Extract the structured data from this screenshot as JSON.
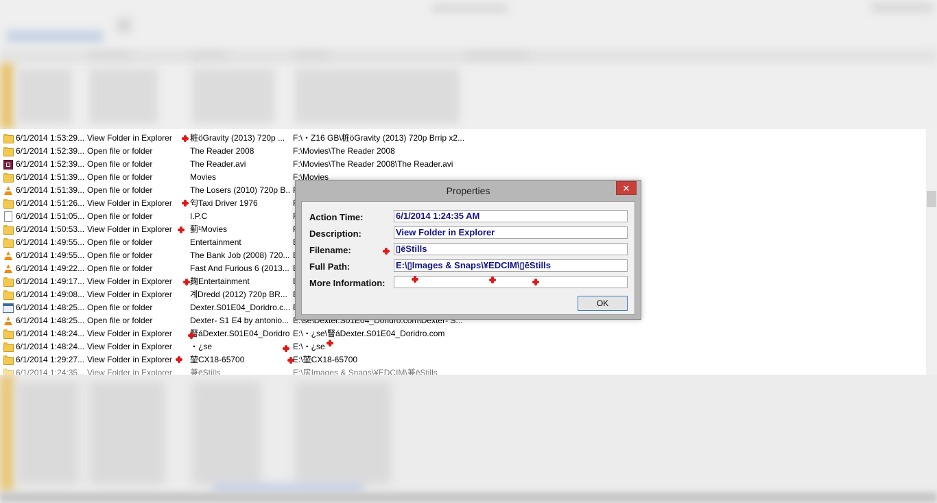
{
  "dialog": {
    "title": "Properties",
    "close_glyph": "✕",
    "ok_label": "OK",
    "fields": [
      {
        "label": "Action Time:",
        "value": "6/1/2014 1:24:35 AM"
      },
      {
        "label": "Description:",
        "value": "View Folder in Explorer"
      },
      {
        "label": "Filename:",
        "value": "▯ēStills"
      },
      {
        "label": "Full Path:",
        "value": "E:\\▯Images & Snaps\\¥EDCIM\\▯ēStills"
      },
      {
        "label": "More Information:",
        "value": ""
      }
    ]
  },
  "list": {
    "rows": [
      {
        "icon": "folder-icon",
        "time": "6/1/2014 1:53:29...",
        "desc": "View Folder in Explorer",
        "file": "粧ӧGravity (2013) 720p ...",
        "path": "F:\\・Z16 GB\\粧ӧGravity (2013) 720p Brrip x2..."
      },
      {
        "icon": "folder-icon",
        "time": "6/1/2014 1:52:39...",
        "desc": "Open file or folder",
        "file": "The Reader 2008",
        "path": "F:\\Movies\\The Reader 2008"
      },
      {
        "icon": "video-file-icon",
        "time": "6/1/2014 1:52:39...",
        "desc": "Open file or folder",
        "file": "The Reader.avi",
        "path": "F:\\Movies\\The Reader 2008\\The Reader.avi"
      },
      {
        "icon": "folder-icon",
        "time": "6/1/2014 1:51:39...",
        "desc": "Open file or folder",
        "file": "Movies",
        "path": "F:\\Movies"
      },
      {
        "icon": "vlc-icon",
        "time": "6/1/2014 1:51:39...",
        "desc": "Open file or folder",
        "file": "The Losers (2010) 720p B...",
        "path": "F"
      },
      {
        "icon": "folder-icon",
        "time": "6/1/2014 1:51:26...",
        "desc": "View Folder in Explorer",
        "file": "匄Taxi Driver 1976",
        "path": "F"
      },
      {
        "icon": "file-icon",
        "time": "6/1/2014 1:51:05...",
        "desc": "Open file or folder",
        "file": "I.P.C",
        "path": "F"
      },
      {
        "icon": "folder-icon",
        "time": "6/1/2014 1:50:53...",
        "desc": "View Folder in Explorer",
        "file": "蓟¹Movies",
        "path": "F"
      },
      {
        "icon": "folder-icon",
        "time": "6/1/2014 1:49:55...",
        "desc": "Open file or folder",
        "file": "Entertainment",
        "path": "E"
      },
      {
        "icon": "vlc-icon",
        "time": "6/1/2014 1:49:55...",
        "desc": "Open file or folder",
        "file": "The Bank Job (2008) 720...",
        "path": "E"
      },
      {
        "icon": "vlc-icon",
        "time": "6/1/2014 1:49:22...",
        "desc": "Open file or folder",
        "file": "Fast And Furious 6 (2013...",
        "path": "E"
      },
      {
        "icon": "folder-icon",
        "time": "6/1/2014 1:49:17...",
        "desc": "View Folder in Explorer",
        "file": "麹Entertainment",
        "path": "E"
      },
      {
        "icon": "folder-icon",
        "time": "6/1/2014 1:49:08...",
        "desc": "View Folder in Explorer",
        "file": "계Dredd (2012) 720p BR...",
        "path": "E"
      },
      {
        "icon": "app-icon",
        "time": "6/1/2014 1:48:25...",
        "desc": "Open file or folder",
        "file": "Dexter.S01E04_Doridro.c...",
        "path": "E"
      },
      {
        "icon": "vlc-icon",
        "time": "6/1/2014 1:48:25...",
        "desc": "Open file or folder",
        "file": "Dexter- S1 E4 by antonio...",
        "path": "E:\\se\\Dexter.S01E04_Doridro.com\\Dexter- S..."
      },
      {
        "icon": "folder-icon",
        "time": "6/1/2014 1:48:24...",
        "desc": "View Folder in Explorer",
        "file": "䁂áDexter.S01E04_Doridro...",
        "path": "E:\\・¿se\\䁂áDexter.S01E04_Doridro.com"
      },
      {
        "icon": "folder-icon",
        "time": "6/1/2014 1:48:24...",
        "desc": "View Folder in Explorer",
        "file": "・¿se",
        "path": "E:\\・¿se"
      },
      {
        "icon": "folder-icon",
        "time": "6/1/2014 1:29:27...",
        "desc": "View Folder in Explorer",
        "file": "堃CX18-65700",
        "path": "E:\\堃CX18-65700"
      },
      {
        "icon": "folder-icon",
        "time": "6/1/2014 1:24:35...",
        "desc": "View Folder in Explorer",
        "file": "兼ēStills",
        "path": "E:\\房Images & Snaps\\¥EDCIM\\兼ēStills"
      }
    ]
  }
}
